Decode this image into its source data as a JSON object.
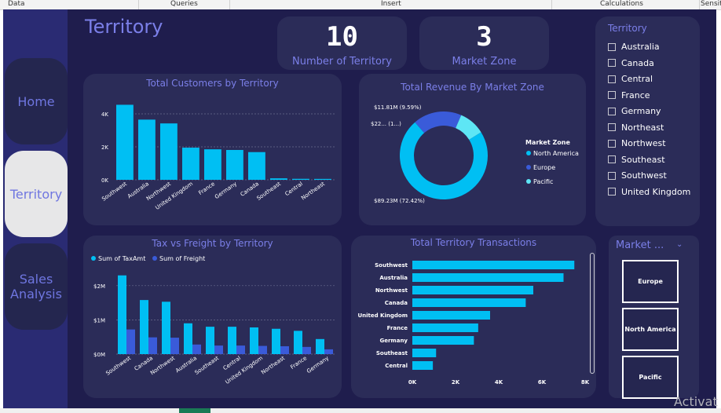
{
  "ribbon": {
    "data": "Data",
    "queries": "Queries",
    "insert": "Insert",
    "calculations": "Calculations",
    "sensitivity": "Sensit"
  },
  "nav": {
    "home": "Home",
    "territory": "Territory",
    "sales": "Sales Analysis"
  },
  "page_title": "Territory",
  "kpis": {
    "territory_count": "10",
    "territory_label": "Number of Territory",
    "zone_count": "3",
    "zone_label": "Market Zone"
  },
  "slicer": {
    "title": "Territory",
    "items": [
      "Australia",
      "Canada",
      "Central",
      "France",
      "Germany",
      "Northeast",
      "Northwest",
      "Southeast",
      "Southwest",
      "United Kingdom"
    ]
  },
  "market_slicer": {
    "title": "Market ...",
    "tiles": [
      "Europe",
      "North America",
      "Pacific"
    ]
  },
  "watermark": "Activat",
  "colors": {
    "bg": "#1f1d4d",
    "card": "#2b2c58",
    "accent": "#7b7fe8",
    "bar": "#00bff3",
    "bar2": "#3a5bd9",
    "pacific": "#5ee6f5"
  },
  "chart_data": [
    {
      "type": "bar",
      "title": "Total Customers by Territory",
      "categories": [
        "Southwest",
        "Australia",
        "Northwest",
        "United Kingdom",
        "France",
        "Germany",
        "Canada",
        "Southeast",
        "Central",
        "Northeast"
      ],
      "values": [
        4550,
        3650,
        3420,
        1950,
        1850,
        1810,
        1680,
        90,
        60,
        55
      ],
      "ylim": [
        0,
        5000
      ],
      "yticks": [
        "0K",
        "2K",
        "4K"
      ],
      "grid": true
    },
    {
      "type": "pie",
      "title": "Total Revenue By Market Zone",
      "legend_title": "Market Zone",
      "labels": [
        "North America",
        "Europe",
        "Pacific"
      ],
      "values": [
        89.23,
        22.0,
        11.81
      ],
      "data_labels": [
        "$89.23M (72.42%)",
        "$22... (1...)",
        "$11.81M (9.59%)"
      ],
      "colors": [
        "#00bff3",
        "#3a5bd9",
        "#5ee6f5"
      ],
      "legend": "right"
    },
    {
      "type": "bar",
      "title": "Tax vs Freight by Territory",
      "categories": [
        "Southwest",
        "Canada",
        "Northwest",
        "Australia",
        "Southeast",
        "Central",
        "United Kingdom",
        "Northeast",
        "France",
        "Germany"
      ],
      "series": [
        {
          "name": "Sum of TaxAmt",
          "values": [
            2.3,
            1.58,
            1.53,
            0.9,
            0.8,
            0.8,
            0.78,
            0.74,
            0.68,
            0.44
          ]
        },
        {
          "name": "Sum of Freight",
          "values": [
            0.72,
            0.49,
            0.48,
            0.28,
            0.25,
            0.25,
            0.24,
            0.23,
            0.21,
            0.14
          ]
        }
      ],
      "ylim": [
        0,
        2.5
      ],
      "yticks": [
        "$0M",
        "$1M",
        "$2M"
      ],
      "legend": "top-left",
      "grid": true
    },
    {
      "type": "bar",
      "title": "Total Territory Transactions",
      "orientation": "horizontal",
      "categories": [
        "Southwest",
        "Australia",
        "Northwest",
        "Canada",
        "United Kingdom",
        "France",
        "Germany",
        "Southeast",
        "Central"
      ],
      "values": [
        7500,
        7000,
        5600,
        5250,
        3600,
        3050,
        2850,
        1100,
        950
      ],
      "xlim": [
        0,
        8000
      ],
      "xticks": [
        "0K",
        "2K",
        "4K",
        "6K",
        "8K"
      ]
    }
  ]
}
